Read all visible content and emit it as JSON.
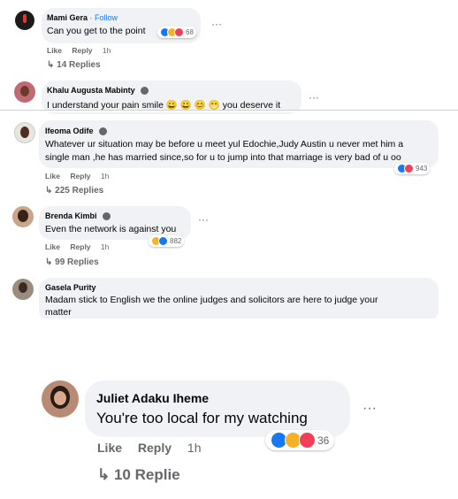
{
  "comments": [
    {
      "name": "Mami Gera",
      "follow": "Follow",
      "text": "Can you get to the point",
      "reactions_count": "68",
      "like": "Like",
      "reply": "Reply",
      "time": "1h",
      "replies": "↳ 14 Replies"
    },
    {
      "name": "Khalu Augusta Mabinty",
      "text": "I understand your pain smile 😀 😀 😊 😁 you deserve it"
    },
    {
      "name": "Ifeoma Odife",
      "text_line1": "Whatever ur situation may be before u meet yul Edochie,Judy Austin u never met him a",
      "text_line2": "single man ,he has married since,so for u to jump into that marriage is very bad of u oo",
      "reactions_count": "943",
      "like": "Like",
      "reply": "Reply",
      "time": "1h",
      "replies": "↳ 225 Replies"
    },
    {
      "name": "Brenda Kimbi",
      "text": "Even the network is against you",
      "reactions_count": "882",
      "like": "Like",
      "reply": "Reply",
      "time": "1h",
      "replies": "↳ 99 Replies"
    },
    {
      "name": "Gasela Purity",
      "text_line1": "Madam stick to English we the online judges and solicitors are here to judge your",
      "text_line2": "matter"
    },
    {
      "name": "Juliet Adaku Iheme",
      "text": "You're too local for my watching",
      "reactions_count": "36",
      "like": "Like",
      "reply": "Reply",
      "time": "1h",
      "replies": "↳ 10 Replie"
    }
  ],
  "more_icon": "···"
}
